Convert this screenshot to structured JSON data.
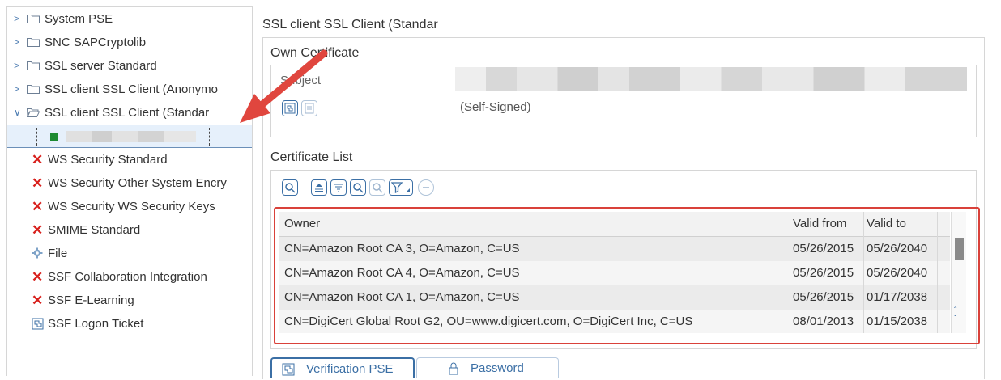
{
  "tree": {
    "items": [
      {
        "label": "System PSE",
        "type": "folder"
      },
      {
        "label": "SNC SAPCryptolib",
        "type": "folder"
      },
      {
        "label": "SSL server Standard",
        "type": "folder"
      },
      {
        "label": "SSL client SSL Client (Anonymo",
        "type": "folder"
      },
      {
        "label": "SSL client SSL Client (Standar",
        "type": "folder-open"
      }
    ],
    "status_items": [
      {
        "label": "WS Security Standard",
        "icon": "red-x-icon"
      },
      {
        "label": "WS Security Other System Encry",
        "icon": "red-x-icon"
      },
      {
        "label": "WS Security WS Security Keys",
        "icon": "red-x-icon"
      },
      {
        "label": "SMIME Standard",
        "icon": "red-x-icon"
      },
      {
        "label": "File",
        "icon": "gear-icon"
      },
      {
        "label": "SSF Collaboration Integration",
        "icon": "red-x-icon"
      },
      {
        "label": "SSF E-Learning",
        "icon": "red-x-icon"
      },
      {
        "label": "SSF Logon Ticket",
        "icon": "ticket-icon"
      }
    ]
  },
  "panel": {
    "title": "SSL client SSL Client (Standar",
    "own_certificate": {
      "title": "Own Certificate",
      "subject_label": "Subject",
      "issuer_text": "(Self-Signed)"
    },
    "certificate_list": {
      "title": "Certificate List",
      "columns": [
        "Owner",
        "Valid from",
        "Valid to"
      ],
      "rows": [
        [
          "CN=Amazon Root CA 3, O=Amazon, C=US",
          "05/26/2015",
          "05/26/2040"
        ],
        [
          "CN=Amazon Root CA 4, O=Amazon, C=US",
          "05/26/2015",
          "05/26/2040"
        ],
        [
          "CN=Amazon Root CA 1, O=Amazon, C=US",
          "05/26/2015",
          "01/17/2038"
        ],
        [
          "CN=DigiCert Global Root G2, OU=www.digicert.com, O=DigiCert Inc, C=US",
          "08/01/2013",
          "01/15/2038"
        ]
      ]
    },
    "tabs": [
      {
        "label": "Verification PSE"
      },
      {
        "label": "Password"
      }
    ]
  },
  "colors": {
    "accent": "#3b6fa5",
    "highlight": "#d9413a",
    "error": "#d8201c"
  }
}
